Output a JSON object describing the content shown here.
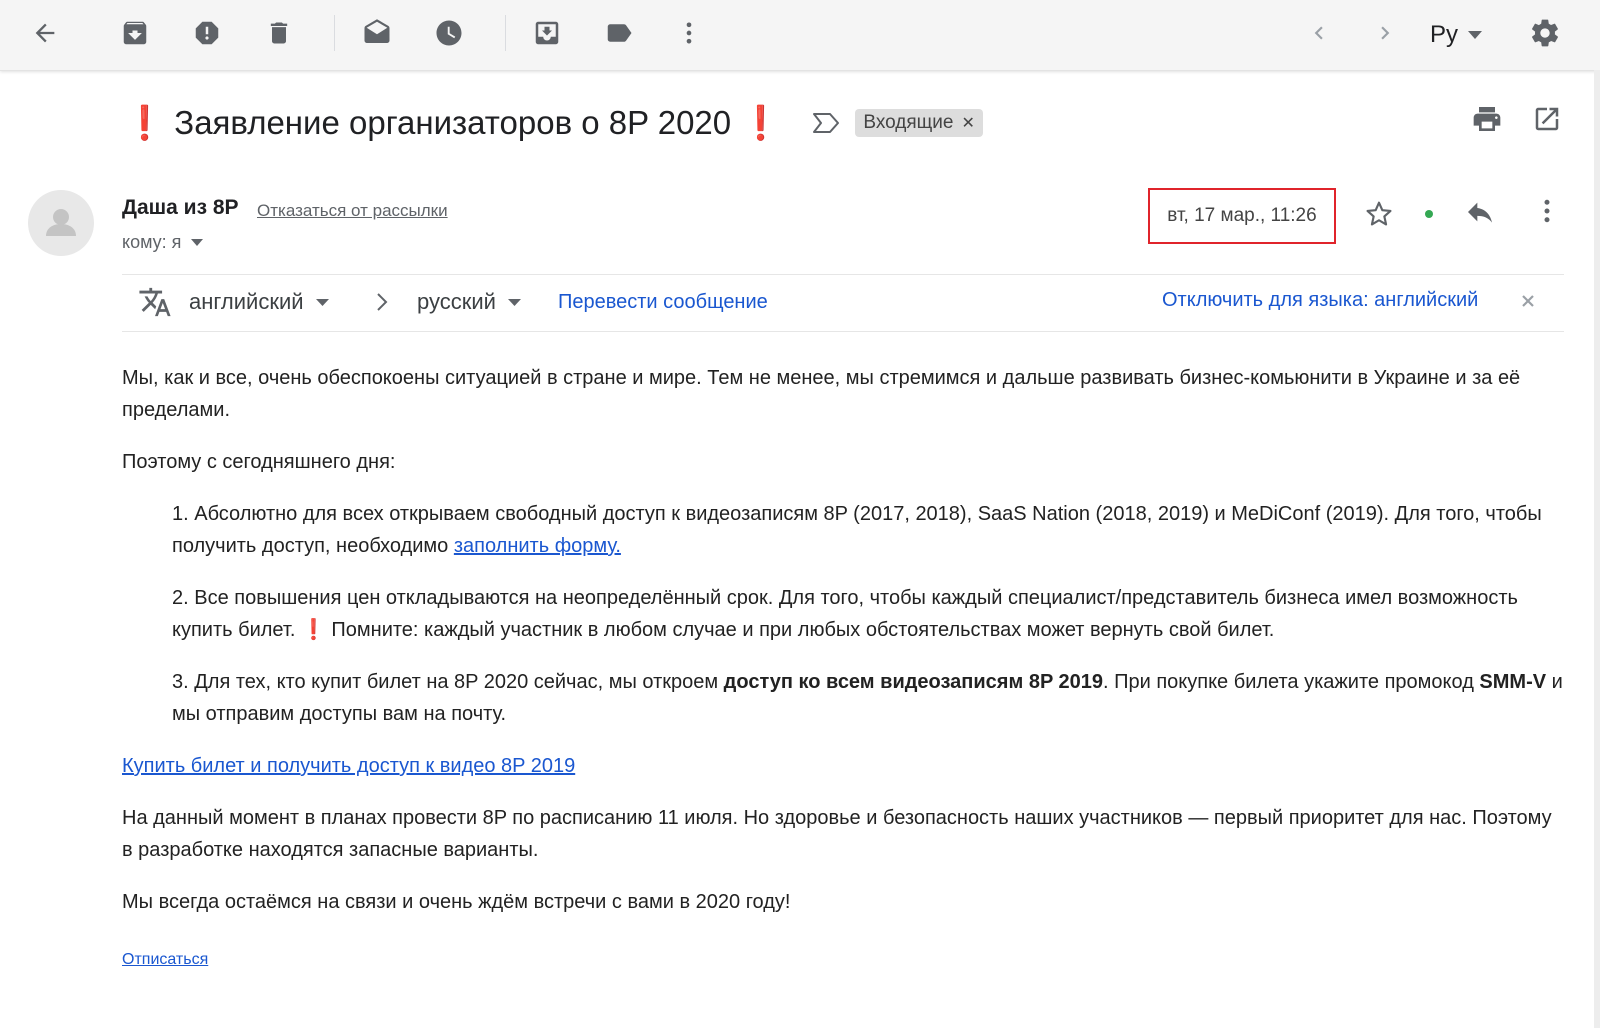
{
  "toolbar": {
    "icons": [
      "back-arrow-icon",
      "archive-icon",
      "report-spam-icon",
      "delete-icon",
      "mark-unread-icon",
      "snooze-icon",
      "move-to-icon",
      "label-icon",
      "more-vert-icon",
      "prev-icon",
      "next-icon",
      "settings-icon"
    ],
    "input_tool_label": "Ру"
  },
  "email": {
    "subject": "Заявление организаторов о 8P 2020",
    "subject_mark": "❗",
    "label": "Входящие",
    "sender_name": "Даша из 8P",
    "unsubscribe_top": "Отказаться от рассылки",
    "to_line": "кому: я",
    "date": "вт, 17 мар., 11:26",
    "highlight_color": "#e0242b"
  },
  "translate": {
    "from_lang": "английский",
    "to_lang": "русский",
    "translate_link": "Перевести сообщение",
    "disable_link": "Отключить для языка: английский"
  },
  "body": {
    "p1": "Мы, как и все, очень обеспокоены ситуацией в стране и мире. Тем не менее, мы стремимся и дальше развивать бизнес-комьюнити в Украине и за её пределами.",
    "p2": "Поэтому с сегодняшнего дня:",
    "item1_text": "1. Абсолютно для всех открываем свободный доступ к видеозаписям 8P (2017, 2018), SaaS Nation (2018, 2019) и MeDiConf (2019). Для того, чтобы получить доступ, необходимо ",
    "item1_link": "заполнить форму.",
    "item2_text_a": "2. Все повышения цен откладываются на неопределённый срок. Для того, чтобы каждый специалист/представитель бизнеса имел возможность купить билет. ",
    "item2_mark": "❗",
    "item2_text_b": "  Помните: каждый участник в любом случае и при любых обстоятельствах может вернуть свой билет.",
    "item3_text_a": "3. Для тех, кто купит билет на 8P 2020 сейчас, мы откроем ",
    "item3_bold": "доступ ко всем видеозаписям 8P 2019",
    "item3_text_b": ". При покупке билета укажите промокод ",
    "item3_code": "SMM-V",
    "item3_text_c": " и мы отправим доступы вам на почту.",
    "cta_link": "Купить билет и получить доступ к видео 8P 2019",
    "p3": "На данный момент в планах провести 8P по расписанию 11 июля. Но здоровье и безопасность наших участников — первый приоритет для нас. Поэтому в разработке находятся запасные варианты.",
    "p4": "Мы всегда остаёмся на связи и очень ждём встречи с вами в 2020 году!",
    "unsubscribe_bottom": "Отписаться"
  }
}
